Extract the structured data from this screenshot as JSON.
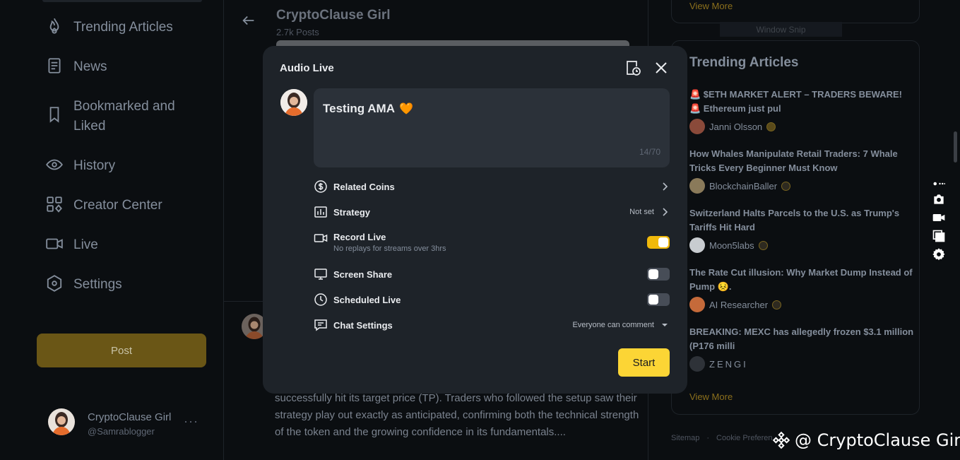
{
  "sidebar": {
    "items": [
      {
        "label": "Trending Articles",
        "icon": "flame-icon"
      },
      {
        "label": "News",
        "icon": "news-icon"
      },
      {
        "label": "Bookmarked and Liked",
        "icon": "bookmark-icon"
      },
      {
        "label": "History",
        "icon": "eye-icon"
      },
      {
        "label": "Creator Center",
        "icon": "grid-icon"
      },
      {
        "label": "Live",
        "icon": "video-icon"
      },
      {
        "label": "Settings",
        "icon": "settings-icon"
      }
    ],
    "post_label": "Post",
    "profile": {
      "name": "CryptoClause Girl",
      "handle": "@Samrablogger",
      "more": "···"
    }
  },
  "feed": {
    "title": "CryptoClause Girl",
    "posts": "2.7k Posts",
    "body": "successfully hit its target price (TP). Traders who followed the setup saw their strategy play out exactly as anticipated, confirming both the technical strength of the token and the growing confidence in its fundamentals...."
  },
  "modal": {
    "title": "Audio Live",
    "input": {
      "value": "Testing AMA",
      "emoji": "🧡",
      "count": "14/70"
    },
    "options": {
      "related_coins": {
        "label": "Related Coins"
      },
      "strategy": {
        "label": "Strategy",
        "value": "Not set"
      },
      "record_live": {
        "label": "Record Live",
        "sub": "No replays for streams over 3hrs",
        "on": true
      },
      "screen_share": {
        "label": "Screen Share",
        "on": false
      },
      "scheduled_live": {
        "label": "Scheduled Live",
        "on": false
      },
      "chat_settings": {
        "label": "Chat Settings",
        "value": "Everyone can comment"
      }
    },
    "start_label": "Start"
  },
  "right": {
    "top_view_more": "View More",
    "ghost_label": "Window Snip",
    "trending_title": "Trending Articles",
    "articles": [
      {
        "title": "🚨 $ETH MARKET ALERT – TRADERS BEWARE! 🚨 Ethereum just pul",
        "author": "Janni Olsson"
      },
      {
        "title": "How Whales Manipulate Retail Traders: 7 Whale Tricks Every Beginner Must Know",
        "author": "BlockchainBaller"
      },
      {
        "title": "Switzerland Halts Parcels to the U.S. as Trump's Tariffs Hit Hard",
        "author": "Moon5labs"
      },
      {
        "title": "The Rate Cut illusion: Why Market Dump Instead of Pump 😣.",
        "author": "AI Researcher"
      },
      {
        "title": "BREAKING: MEXC has allegedly frozen $3.1 million (P176 milli",
        "author": "ZENGI"
      }
    ],
    "view_more": "View More",
    "footer": [
      "Sitemap",
      "·",
      "Cookie Preferen"
    ],
    "watermark": "@ CryptoClause Girl"
  },
  "colors": {
    "accent": "#fcd535",
    "modal_bg": "#1e2329",
    "page_bg": "#0b0e11"
  }
}
